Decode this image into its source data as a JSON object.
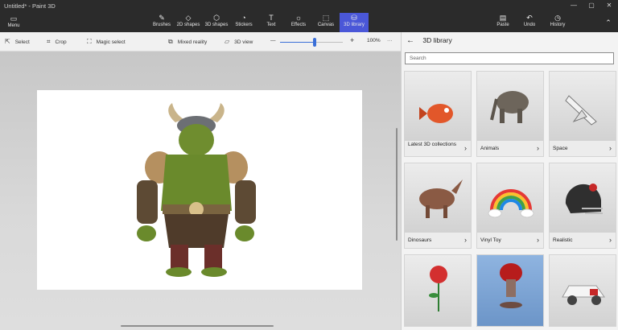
{
  "window": {
    "title": "Untitled* - Paint 3D",
    "controls": [
      "—",
      "▢",
      "✕"
    ]
  },
  "ribbon": {
    "menu": {
      "label": "Menu",
      "icon": "menu-icon"
    },
    "tools": [
      {
        "label": "Brushes",
        "icon": "brush-icon"
      },
      {
        "label": "2D shapes",
        "icon": "2d-shapes-icon"
      },
      {
        "label": "3D shapes",
        "icon": "3d-cube-icon"
      },
      {
        "label": "Stickers",
        "icon": "sticker-icon"
      },
      {
        "label": "Text",
        "icon": "text-icon"
      },
      {
        "label": "Effects",
        "icon": "sun-effects-icon"
      },
      {
        "label": "Canvas",
        "icon": "canvas-crop-icon"
      },
      {
        "label": "3D library",
        "icon": "3d-library-icon",
        "active": true
      }
    ],
    "right": [
      {
        "label": "Paste",
        "icon": "clipboard-icon"
      },
      {
        "label": "Undo",
        "icon": "undo-icon"
      },
      {
        "label": "History",
        "icon": "history-clock-icon"
      }
    ],
    "collapse": "⌃"
  },
  "options": {
    "select": "Select",
    "crop": "Crop",
    "magic_select": "Magic select",
    "mixed_reality": "Mixed reality",
    "view_3d": "3D view",
    "zoom_minus": "—",
    "zoom_plus": "+",
    "zoom": "100%",
    "more": "···",
    "zoom_fraction": 0.55
  },
  "library": {
    "back": "←",
    "title": "3D library",
    "search_placeholder": "Search",
    "cards": [
      {
        "name": "Latest 3D collections"
      },
      {
        "name": "Animals"
      },
      {
        "name": "Space"
      },
      {
        "name": "Dinosaurs"
      },
      {
        "name": "Vinyl Toy"
      },
      {
        "name": "Realistic"
      },
      {
        "name": ""
      },
      {
        "name": ""
      },
      {
        "name": ""
      }
    ],
    "chevron": "›"
  },
  "colors": {
    "accent": "#4a57d8",
    "titlebar": "#2b2b2b",
    "panel": "#f3f3f3"
  }
}
